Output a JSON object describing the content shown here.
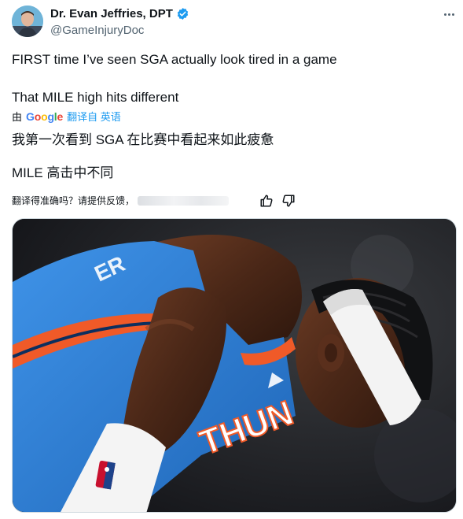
{
  "author": {
    "display_name": "Dr. Evan Jeffries, DPT",
    "handle": "@GameInjuryDoc",
    "verified": true
  },
  "tweet": {
    "line1": "FIRST time I’ve seen SGA actually look tired in a game",
    "line2": "That MILE high hits different"
  },
  "translation": {
    "by_label": "由",
    "provider": "Google",
    "link_label": "翻译自 英语",
    "line1": "我第一次看到 SGA 在比赛中看起来如此疲惫",
    "line2": "MILE 高击中不同"
  },
  "feedback": {
    "prompt": "翻译得准确吗？请提供反馈，"
  },
  "media": {
    "jersey_text": "THUN"
  },
  "colors": {
    "accent": "#1d9bf0",
    "secondary_text": "#536471",
    "jersey_blue": "#2e7fd6",
    "jersey_orange": "#f05a28"
  },
  "icons": [
    "verified-badge-icon",
    "more-icon",
    "thumbs-up-icon",
    "thumbs-down-icon",
    "nba-logo-icon"
  ]
}
